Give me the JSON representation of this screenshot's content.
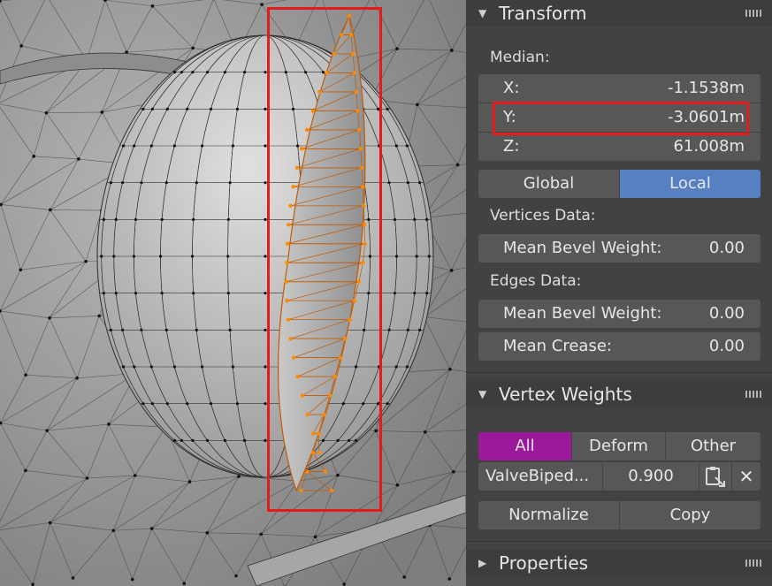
{
  "transform": {
    "title": "Transform",
    "median_label": "Median:",
    "x": {
      "label": "X:",
      "value": "-1.1538m"
    },
    "y": {
      "label": "Y:",
      "value": "-3.0601m"
    },
    "z": {
      "label": "Z:",
      "value": "61.008m"
    },
    "space_global": "Global",
    "space_local": "Local",
    "space_selected": "Local",
    "vertices_data_label": "Vertices Data:",
    "vertex_bevel": {
      "label": "Mean Bevel Weight:",
      "value": "0.00"
    },
    "edges_data_label": "Edges Data:",
    "edge_bevel": {
      "label": "Mean Bevel Weight:",
      "value": "0.00"
    },
    "edge_crease": {
      "label": "Mean Crease:",
      "value": "0.00"
    }
  },
  "vertex_weights": {
    "title": "Vertex Weights",
    "tabs": [
      "All",
      "Deform",
      "Other"
    ],
    "active_tab": "All",
    "group_name": "ValveBiped...",
    "group_weight": "0.900",
    "normalize_label": "Normalize",
    "copy_label": "Copy"
  },
  "properties": {
    "title": "Properties"
  },
  "colors": {
    "accent_blue": "#5680c2",
    "accent_purple": "#9a1a9a",
    "highlight_red": "#e31b1b",
    "selected_vertex": "#ff8a00"
  }
}
